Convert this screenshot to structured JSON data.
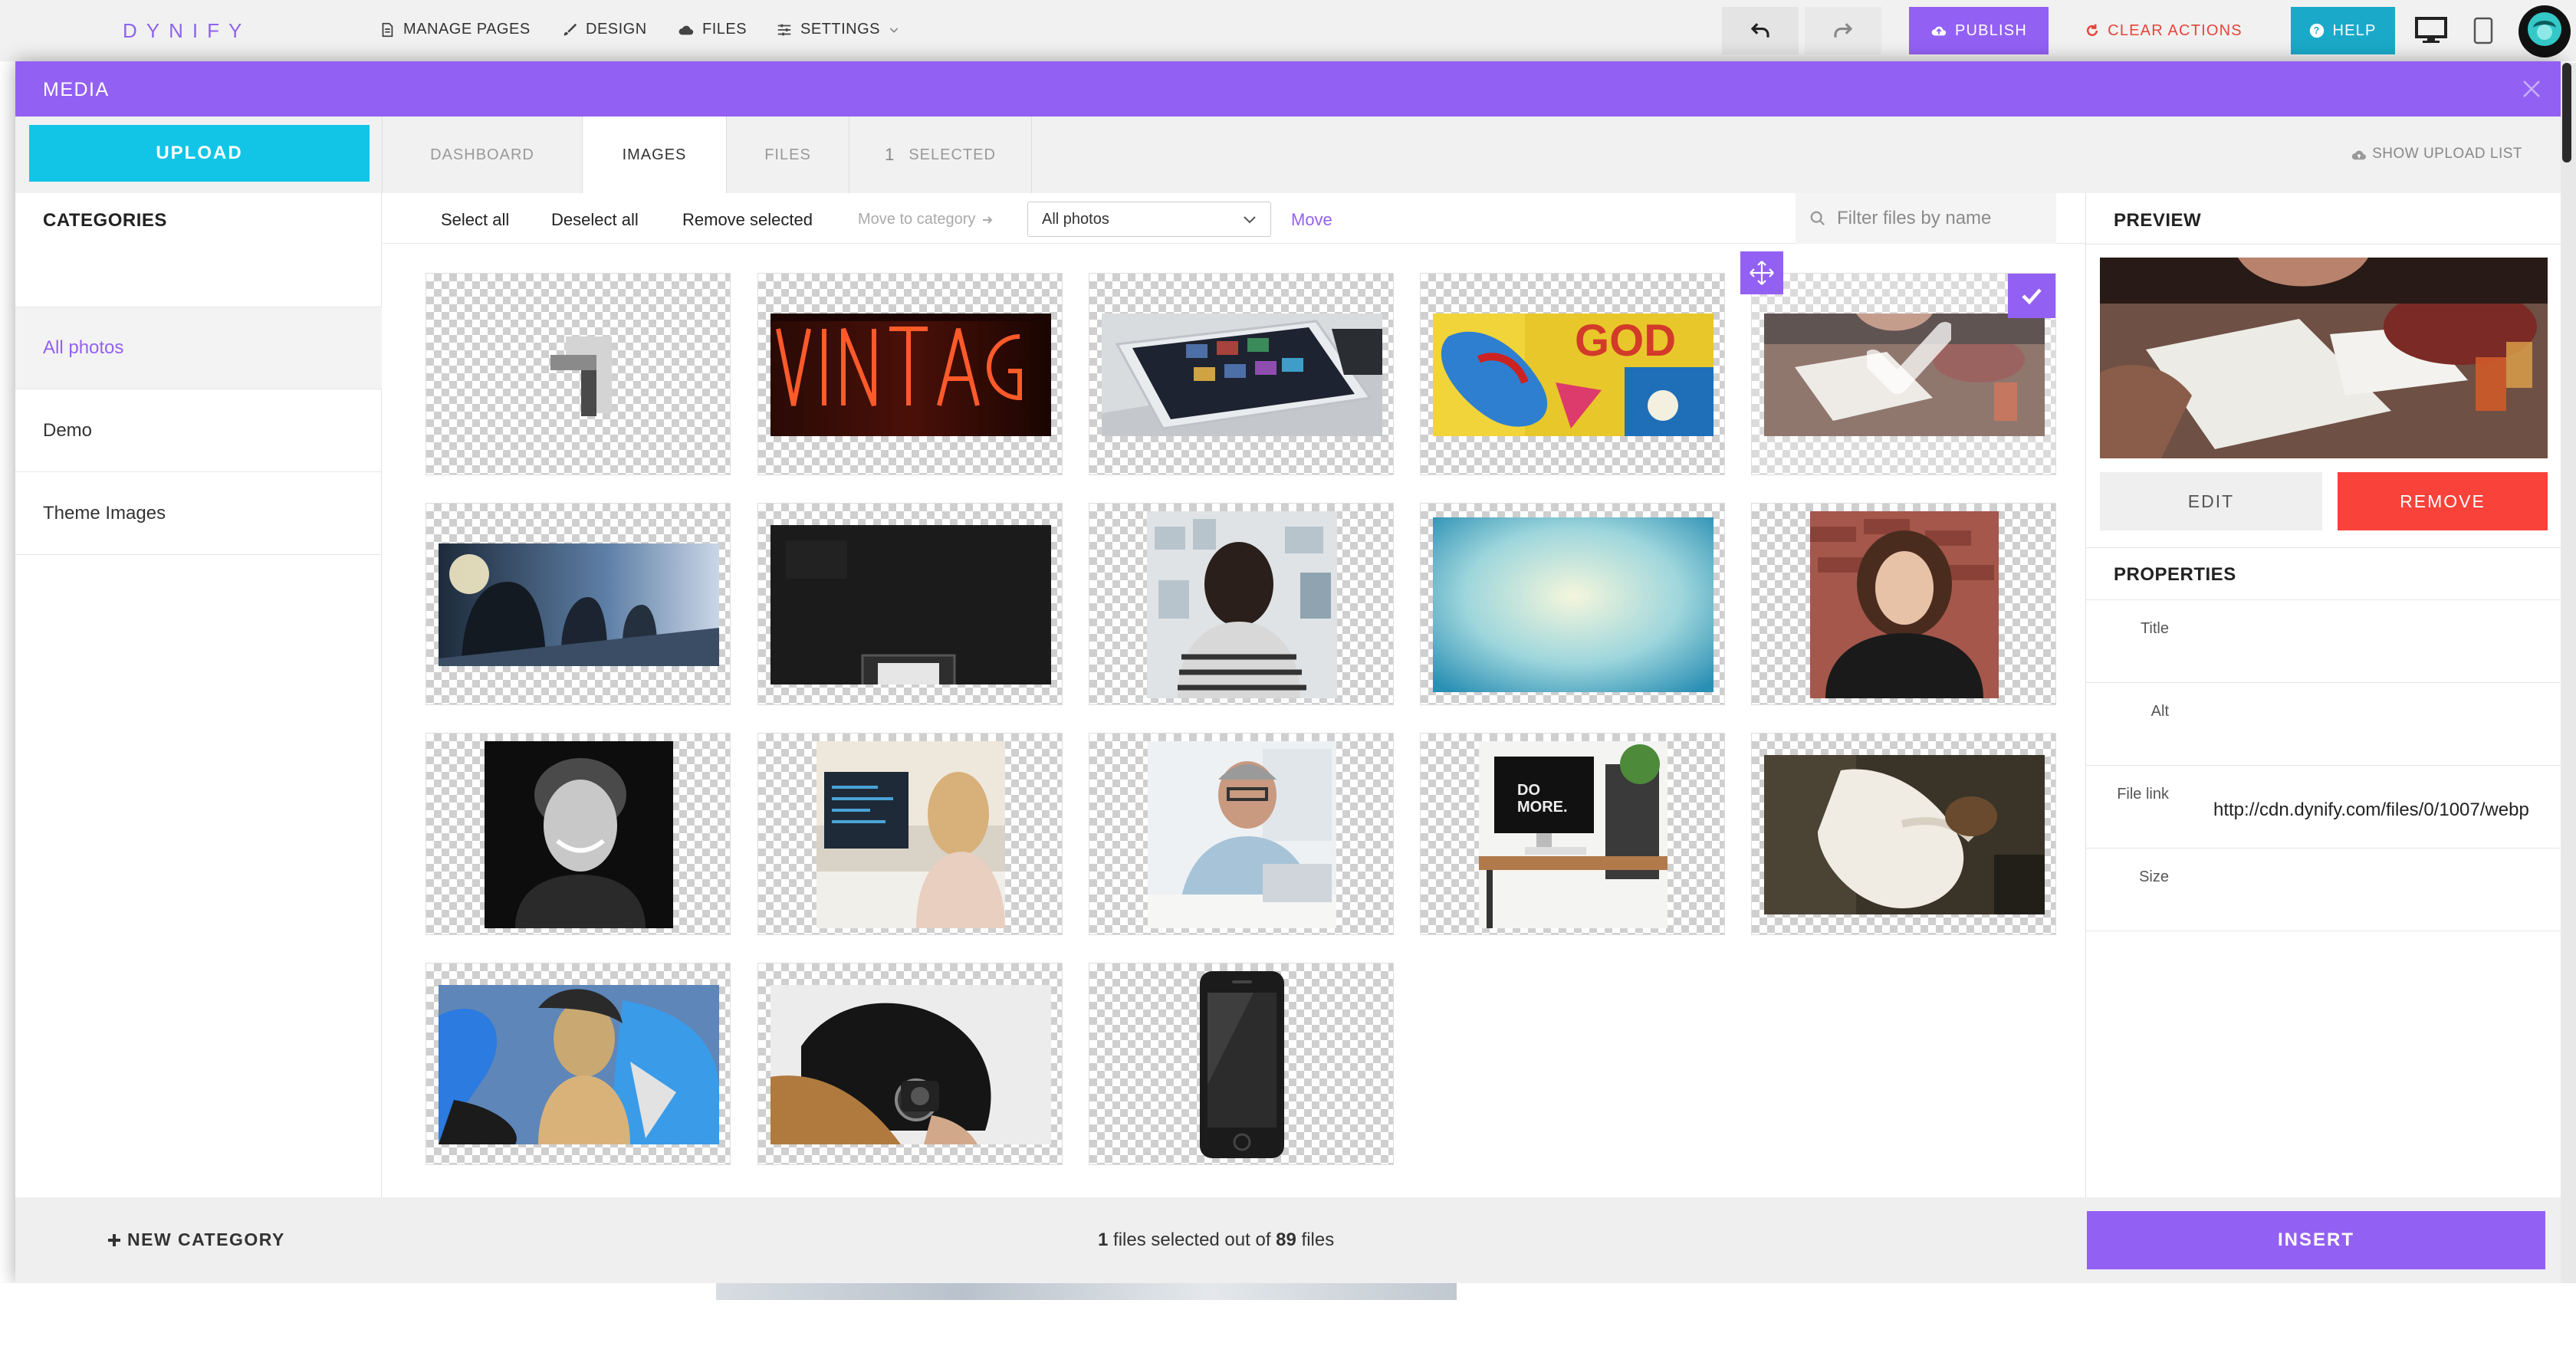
{
  "app": {
    "logo": "DYNIFY"
  },
  "topnav": {
    "items": [
      {
        "label": "MANAGE PAGES",
        "icon": "page-icon"
      },
      {
        "label": "DESIGN",
        "icon": "brush-icon"
      },
      {
        "label": "FILES",
        "icon": "cloud-icon"
      },
      {
        "label": "SETTINGS",
        "icon": "sliders-icon"
      }
    ],
    "publish_label": "PUBLISH",
    "clear_label": "CLEAR ACTIONS",
    "help_label": "HELP"
  },
  "modal": {
    "title": "MEDIA",
    "upload_label": "UPLOAD",
    "tabs": [
      {
        "label": "DASHBOARD"
      },
      {
        "label": "IMAGES",
        "active": true
      },
      {
        "label": "FILES"
      },
      {
        "label": "SELECTED",
        "count": "1"
      }
    ],
    "show_upload_list": "SHOW UPLOAD LIST"
  },
  "categories": {
    "title": "CATEGORIES",
    "items": [
      {
        "label": "All photos",
        "active": true
      },
      {
        "label": "Demo"
      },
      {
        "label": "Theme Images"
      }
    ],
    "new_category_label": "NEW CATEGORY"
  },
  "toolbar": {
    "select_all": "Select all",
    "deselect_all": "Deselect all",
    "remove_selected": "Remove selected",
    "move_to_category": "Move to category",
    "category_value": "All photos",
    "move": "Move",
    "filter_placeholder": "Filter files by name"
  },
  "grid": {
    "tiles": [
      "logo-shape",
      "vintage-neon",
      "tablet",
      "graffiti-god",
      "meeting-table",
      "cyclists",
      "dark-desk",
      "man-wall",
      "blue-gradient",
      "woman-portrait",
      "man-portrait-bw",
      "woman-computer",
      "man-laptop",
      "desk-imac",
      "woman-sleeve",
      "graffiti-woman",
      "camera-coat",
      "smartphone"
    ],
    "selected_tile": "meeting-table"
  },
  "preview": {
    "title": "PREVIEW",
    "edit_label": "EDIT",
    "remove_label": "REMOVE",
    "properties_title": "PROPERTIES",
    "props": [
      {
        "label": "Title",
        "value": ""
      },
      {
        "label": "Alt",
        "value": ""
      },
      {
        "label": "File link",
        "value": "http://cdn.dynify.com/files/0/1007/webp"
      },
      {
        "label": "Size",
        "value": ""
      }
    ]
  },
  "footer": {
    "selected_count": "1",
    "status_mid": " files selected out of ",
    "total_count": "89",
    "status_end": " files",
    "insert_label": "INSERT"
  },
  "colors": {
    "accent_purple": "#9360f4",
    "upload_cyan": "#12c5e6",
    "help_cyan": "#1aa9c9",
    "remove_red": "#f9423a",
    "clear_red": "#e6443a"
  }
}
